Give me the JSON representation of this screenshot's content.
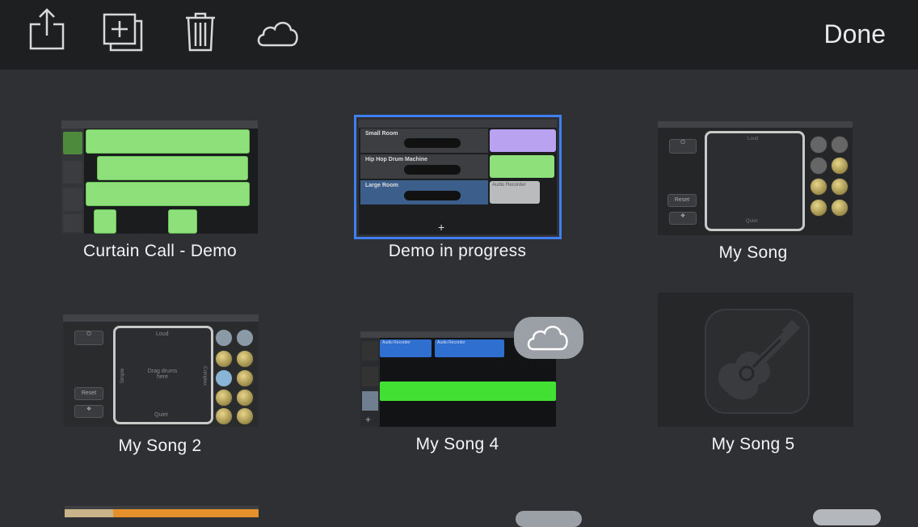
{
  "toolbar": {
    "done_label": "Done",
    "icons": [
      "share-icon",
      "duplicate-icon",
      "trash-icon",
      "cloud-icon"
    ]
  },
  "songs": [
    {
      "title": "Curtain Call - Demo"
    },
    {
      "title": "Demo in progress",
      "selected": true,
      "tracks": [
        "Small Room",
        "Hip Hop Drum Machine",
        "Large Room"
      ],
      "region_label": "Audio Recorder"
    },
    {
      "title": "My Song",
      "reset_label": "Reset",
      "pad_labels": [
        "Loud",
        "Quiet"
      ]
    },
    {
      "title": "My Song 2",
      "reset_label": "Reset",
      "pad_labels": [
        "Loud",
        "Quiet",
        "Simple",
        "Complex",
        "Drag drums here"
      ]
    },
    {
      "title": "My Song 4",
      "region_labels": [
        "Audio Recorder",
        "Audio Recorder"
      ],
      "in_cloud": true
    },
    {
      "title": "My Song 5"
    }
  ],
  "colors": {
    "background": "#2e3034",
    "toolbar": "#1d1f21",
    "selection": "#3f7ff0",
    "region_green": "#8ee07a",
    "cloud_badge": "#9aa0a6"
  }
}
